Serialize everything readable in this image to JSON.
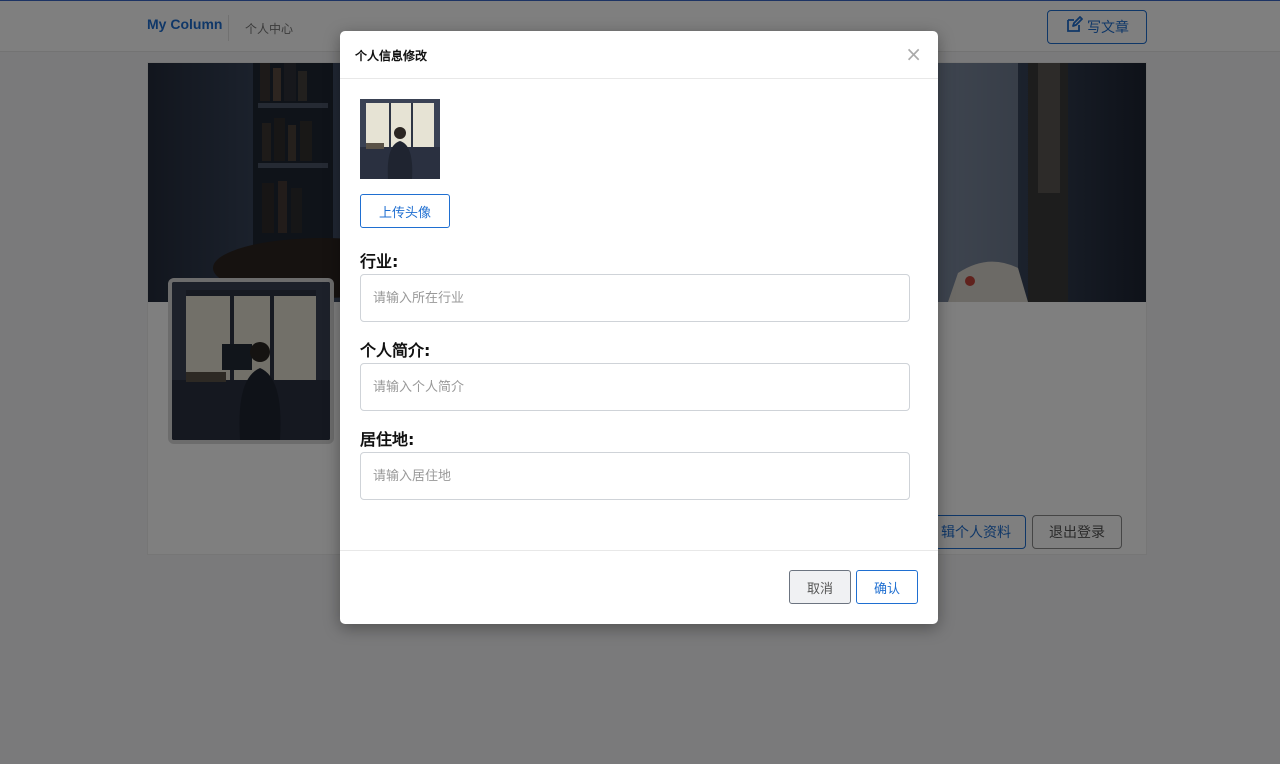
{
  "header": {
    "logo": "My Column",
    "nav_link": "个人中心",
    "write_label": "写文章",
    "write_icon": "edit-icon"
  },
  "profile": {
    "edit_label": "辑个人资料",
    "logout_label": "退出登录"
  },
  "modal": {
    "title": "个人信息修改",
    "close_glyph": "×",
    "upload_label": "上传头像",
    "fields": [
      {
        "label": "行业:",
        "value": "",
        "placeholder": "请输入所在行业"
      },
      {
        "label": "个人简介:",
        "value": "",
        "placeholder": "请输入个人简介"
      },
      {
        "label": "居住地:",
        "value": "",
        "placeholder": "请输入居住地"
      }
    ],
    "cancel_label": "取消",
    "confirm_label": "确认"
  },
  "colors": {
    "accent": "#1f6fd1",
    "overlay": "rgba(0,0,0,0.5)"
  }
}
